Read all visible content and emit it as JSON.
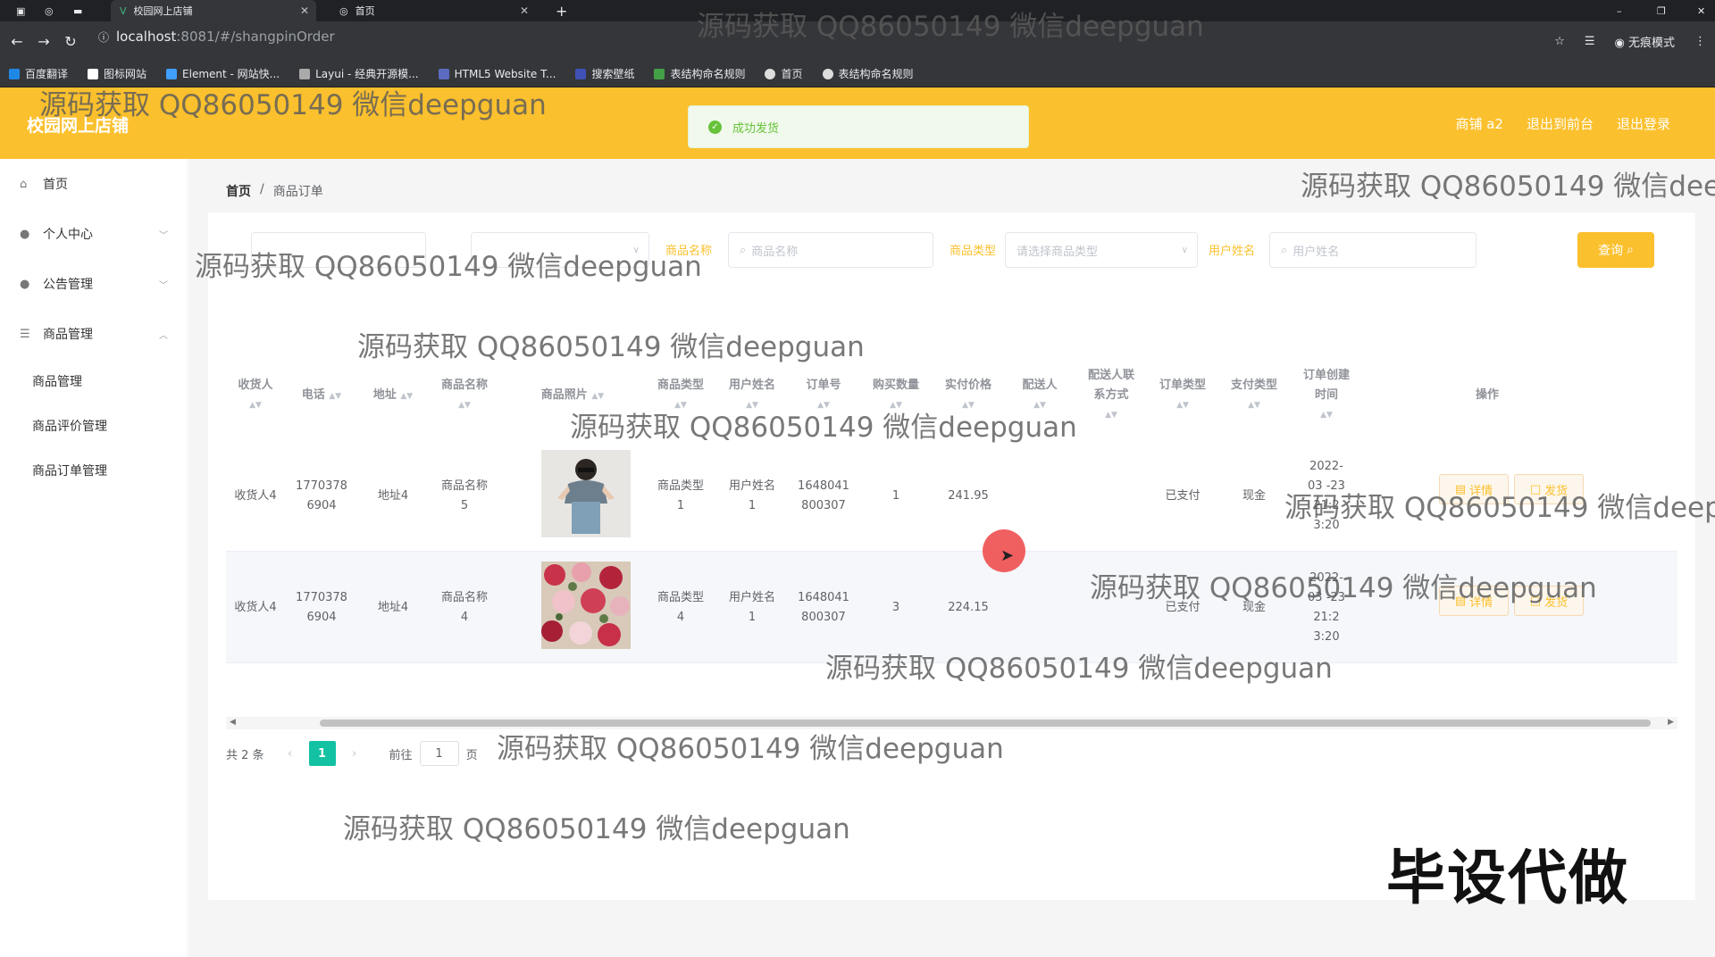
{
  "browser": {
    "tabs": [
      {
        "label": "校园网上店铺",
        "active": true
      },
      {
        "label": "首页",
        "active": false
      }
    ],
    "url_host": "localhost",
    "url_path": ":8081/#/shangpinOrder",
    "profile_label": "无痕模式",
    "bookmarks": [
      "百度翻译",
      "图标网站",
      "Element - 网站快...",
      "Layui - 经典开源模...",
      "HTML5 Website T...",
      "搜索壁纸",
      "表结构命名规则",
      "首页",
      "表结构命名规则"
    ]
  },
  "header": {
    "title": "校园网上店铺",
    "links": [
      "商铺 a2",
      "退出到前台",
      "退出登录"
    ],
    "toast": "成功发货",
    "bg_color": "#fbc02d"
  },
  "sidebar": {
    "items": [
      {
        "label": "首页",
        "icon": "home-icon"
      },
      {
        "label": "个人中心",
        "icon": "user-icon"
      },
      {
        "label": "公告管理",
        "icon": "user-icon"
      },
      {
        "label": "商品管理",
        "icon": "sliders-icon"
      }
    ],
    "sub_items": [
      "商品管理",
      "商品评价管理",
      "商品订单管理"
    ]
  },
  "breadcrumb": [
    "首页",
    "商品订单"
  ],
  "search": {
    "labels": [
      "商品名称",
      "商品类型",
      "用户姓名"
    ],
    "placeholders": [
      "商品名称",
      "请选择商品类型",
      "用户姓名"
    ],
    "button": "查询"
  },
  "table": {
    "headers": [
      "收货人",
      "电话",
      "地址",
      "商品名称",
      "商品照片",
      "商品类型",
      "用户姓名",
      "订单号",
      "购买数量",
      "实付价格",
      "配送人",
      "配送人联系方式",
      "订单类型",
      "支付类型",
      "订单创建时间",
      "操作"
    ],
    "rows": [
      {
        "receiver": "收货人4",
        "phone": "1770378 6904",
        "address": "地址4",
        "product": "商品名称 5",
        "type": "商品类型 1",
        "user": "用户姓名 1",
        "order_no": "1648041 800307",
        "qty": "1",
        "price": "241.95",
        "courier": "",
        "courier_phone": "",
        "order_type": "已支付",
        "pay_type": "现金",
        "created": "2022-03 -23 21:2 3:20",
        "ops": [
          "详情",
          "发货"
        ]
      },
      {
        "receiver": "收货人4",
        "phone": "1770378 6904",
        "address": "地址4",
        "product": "商品名称 4",
        "type": "商品类型 4",
        "user": "用户姓名 1",
        "order_no": "1648041 800307",
        "qty": "3",
        "price": "224.15",
        "courier": "",
        "courier_phone": "",
        "order_type": "已支付",
        "pay_type": "现金",
        "created": "2022-03 -23 21:2 3:20",
        "ops": [
          "详情",
          "发货"
        ]
      }
    ]
  },
  "pagination": {
    "total": "共 2 条",
    "current": "1",
    "goto": "前往",
    "goto_value": "1",
    "page_unit": "页"
  },
  "watermark": "源码获取 QQ86050149 微信deepguan",
  "stamp": "毕设代做"
}
